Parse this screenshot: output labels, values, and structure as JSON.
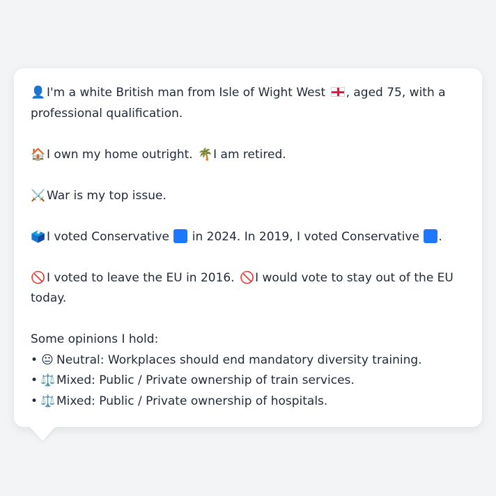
{
  "profile": {
    "intro": {
      "person_emoji": "👤",
      "text_before_flag": "I'm a white British man from Isle of Wight West",
      "text_after_flag": ", aged 75, with a professional qualification."
    },
    "home": {
      "house_emoji": "🏠",
      "home_text": "I own my home outright.",
      "palm_emoji": "🌴",
      "work_text": "I am retired."
    },
    "issue": {
      "swords_emoji": "⚔️",
      "text": "War is my top issue."
    },
    "vote": {
      "ballot_emoji": "🗳️",
      "text_2024_before": "I voted Conservative",
      "text_2024_after": "in 2024. In 2019, I voted Conservative",
      "text_end": "."
    },
    "eu": {
      "no_emoji": "🚫",
      "text_2016": "I voted to leave the EU in 2016.",
      "no_emoji_2": "🚫",
      "text_today": "I would vote to stay out of the EU today."
    },
    "opinions": {
      "heading": "Some opinions I hold:",
      "items": [
        {
          "bullet": "•",
          "emoji": "😐",
          "text": "Neutral: Workplaces should end mandatory diversity training."
        },
        {
          "bullet": "•",
          "emoji": "⚖️",
          "text": "Mixed: Public / Private ownership of train services."
        },
        {
          "bullet": "•",
          "emoji": "⚖️",
          "text": "Mixed: Public / Private ownership of hospitals."
        }
      ]
    }
  },
  "colors": {
    "conservative_blue": "#1e78ff",
    "card_background": "#ffffff",
    "page_background": "#f3f4f6"
  }
}
